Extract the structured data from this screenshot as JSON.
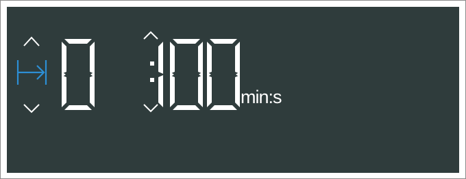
{
  "display": {
    "digits": [
      "0",
      "1",
      "0",
      "0"
    ],
    "blank_position_after": 1,
    "separator": ":",
    "unit": "min:s"
  },
  "colors": {
    "panel_background": "#2f3c3c",
    "segment": "#ffffff",
    "mode_icon_active": "#2d8fd5"
  },
  "icons": {
    "mode": "skip-to-end-icon",
    "up_left": "chevron-up-icon",
    "down_left": "chevron-down-icon",
    "up_right": "chevron-up-icon",
    "down_right": "chevron-down-icon"
  }
}
